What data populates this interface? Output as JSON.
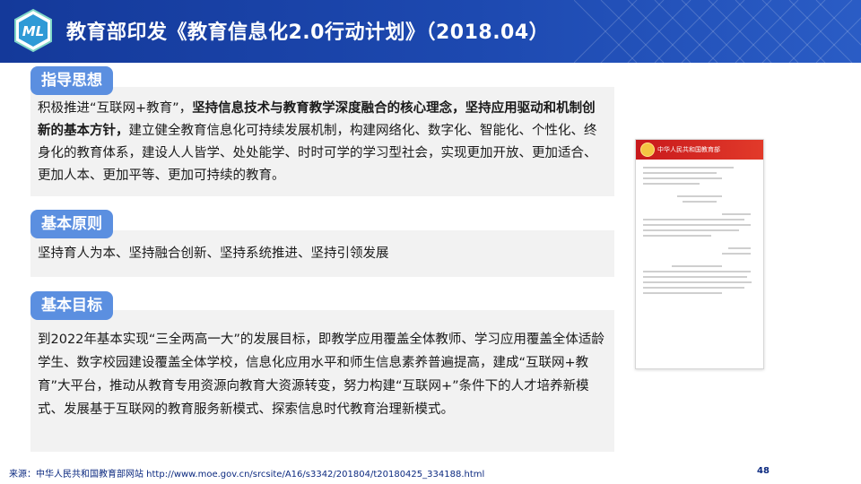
{
  "header": {
    "logo_text": "ML",
    "title": "教育部印发《教育信息化2.0行动计划》（2018.04）"
  },
  "sections": [
    {
      "tag": "指导思想",
      "text_parts": [
        {
          "text": "积极推进“互联网+教育”，",
          "bold": false
        },
        {
          "text": "坚持信息技术与教育教学深度融合的核心理念，坚持应用驱动和机制创新的基本方针，",
          "bold": true
        },
        {
          "text": "建立健全教育信息化可持续发展机制，构建网络化、数字化、智能化、个性化、终身化的教育体系，建设人人皆学、处处能学、时时可学的学习型社会，实现更加开放、更加适合、更加人本、更加平等、更加可持续的教育。",
          "bold": false
        }
      ]
    },
    {
      "tag": "基本原则",
      "text_parts": [
        {
          "text": "坚持育人为本、坚持融合创新、坚持系统推进、坚持引领发展",
          "bold": false
        }
      ]
    },
    {
      "tag": "基本目标",
      "text_parts": [
        {
          "text": "到2022年基本实现“三全两高一大”的发展目标，即教学应用覆盖全体教师、学习应用覆盖全体适龄学生、数字校园建设覆盖全体学校，信息化应用水平和师生信息素养普遍提高，建成“互联网+教育”大平台，推动从教育专用资源向教育大资源转变，努力构建“互联网+”条件下的人才培养新模式、发展基于互联网的教育服务新模式、探索信息时代教育治理新模式。",
          "bold": false
        }
      ]
    }
  ],
  "document_image": {
    "banner_text": "中华人民共和国教育部"
  },
  "footer": {
    "source": "来源：中华人民共和国教育部网站 http://www.moe.gov.cn/srcsite/A16/s3342/201804/t20180425_334188.html",
    "page_number": "48"
  }
}
